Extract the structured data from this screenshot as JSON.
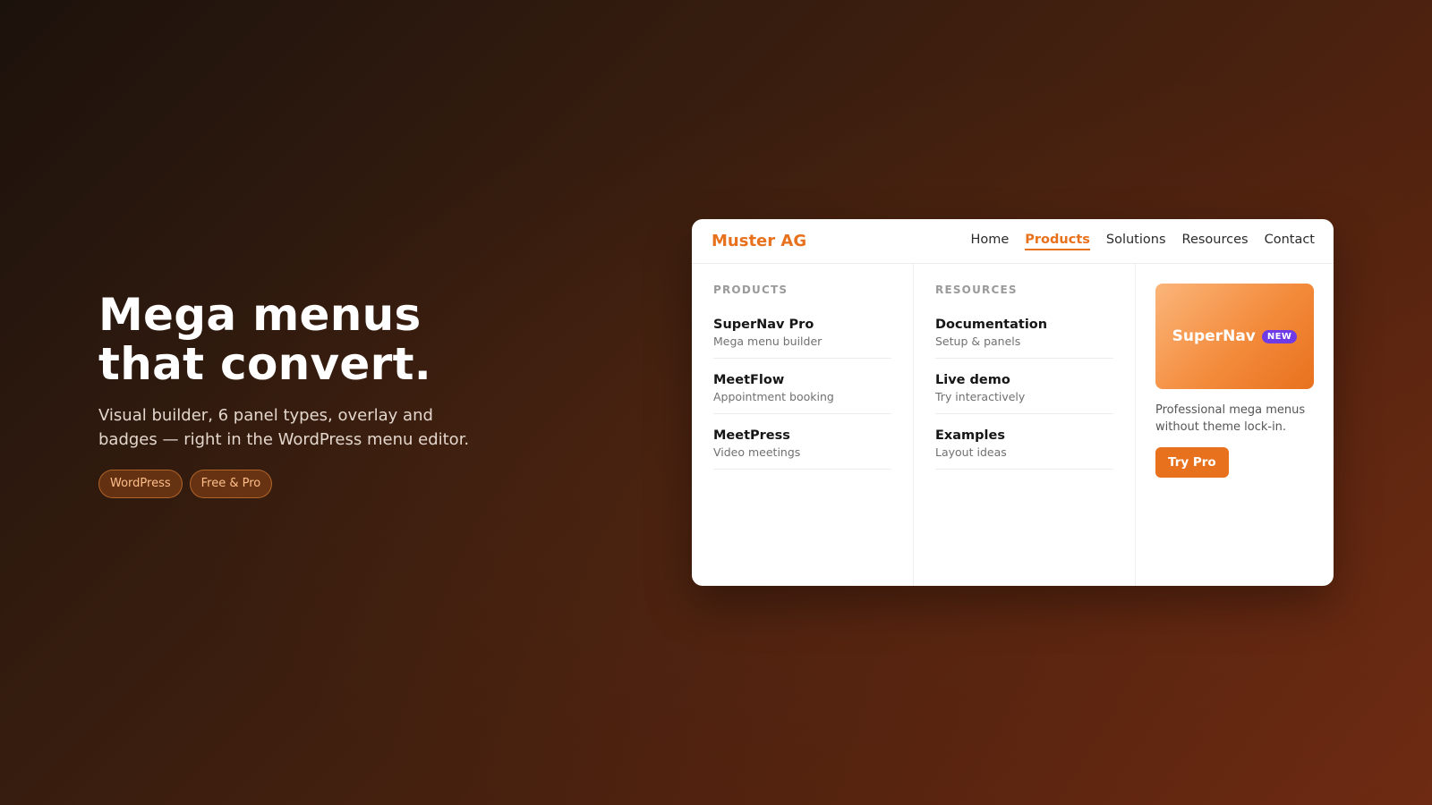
{
  "hero": {
    "title_line1": "Mega menus",
    "title_line2": "that convert.",
    "subtitle": "Visual builder, 6 panel types, overlay and badges — right in the WordPress menu editor.",
    "pills": [
      "WordPress",
      "Free & Pro"
    ]
  },
  "site": {
    "brand": "Muster AG",
    "nav": [
      "Home",
      "Products",
      "Solutions",
      "Resources",
      "Contact"
    ],
    "active_nav": "Products"
  },
  "menu": {
    "products": {
      "heading": "PRODUCTS",
      "items": [
        {
          "title": "SuperNav Pro",
          "subtitle": "Mega menu builder"
        },
        {
          "title": "MeetFlow",
          "subtitle": "Appointment booking"
        },
        {
          "title": "MeetPress",
          "subtitle": "Video meetings"
        }
      ]
    },
    "resources": {
      "heading": "RESOURCES",
      "items": [
        {
          "title": "Documentation",
          "subtitle": "Setup & panels"
        },
        {
          "title": "Live demo",
          "subtitle": "Try interactively"
        },
        {
          "title": "Examples",
          "subtitle": "Layout ideas"
        }
      ]
    },
    "promo": {
      "name": "SuperNav",
      "badge": "NEW",
      "description": "Professional mega menus without theme lock-in.",
      "cta": "Try Pro"
    }
  },
  "colors": {
    "accent": "#e8711d",
    "badge": "#6e3be6"
  }
}
